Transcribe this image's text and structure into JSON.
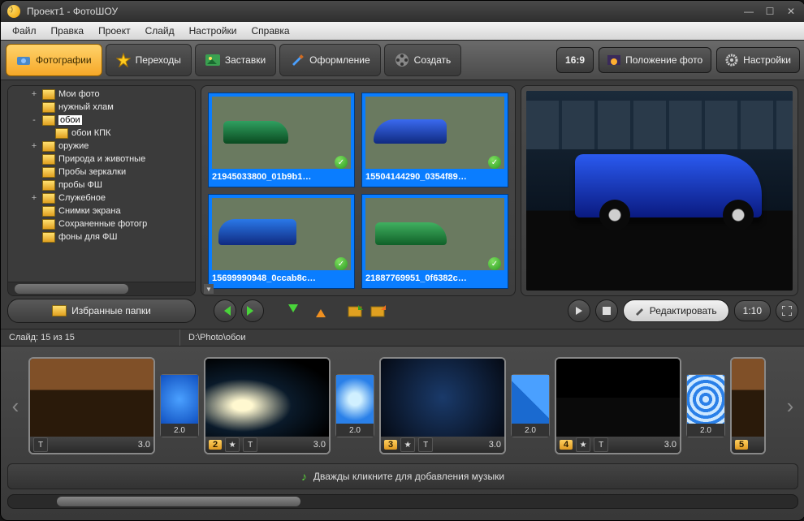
{
  "window": {
    "title": "Проект1 - ФотоШОУ"
  },
  "menu": {
    "file": "Файл",
    "edit": "Правка",
    "project": "Проект",
    "slide": "Слайд",
    "settings": "Настройки",
    "help": "Справка"
  },
  "tabs": {
    "photos": "Фотографии",
    "transitions": "Переходы",
    "intros": "Заставки",
    "design": "Оформление",
    "create": "Создать"
  },
  "toolbar_right": {
    "aspect": "16:9",
    "photopos": "Положение фото",
    "settings": "Настройки"
  },
  "folders": {
    "items": [
      {
        "indent": 1,
        "exp": "+",
        "label": "Мои фото"
      },
      {
        "indent": 1,
        "exp": "",
        "label": "нужный хлам"
      },
      {
        "indent": 1,
        "exp": "-",
        "label": "обои",
        "selected": true
      },
      {
        "indent": 2,
        "exp": "",
        "label": "обои КПК"
      },
      {
        "indent": 1,
        "exp": "+",
        "label": "оружие"
      },
      {
        "indent": 1,
        "exp": "",
        "label": "Природа и животные"
      },
      {
        "indent": 1,
        "exp": "",
        "label": "Пробы зеркалки"
      },
      {
        "indent": 1,
        "exp": "",
        "label": "пробы ФШ"
      },
      {
        "indent": 1,
        "exp": "+",
        "label": "Служебное"
      },
      {
        "indent": 1,
        "exp": "",
        "label": "Снимки экрана"
      },
      {
        "indent": 1,
        "exp": "",
        "label": "Сохраненные фотогр"
      },
      {
        "indent": 1,
        "exp": "",
        "label": "фоны для ФШ"
      }
    ],
    "favorites_btn": "Избранные папки"
  },
  "thumbs": [
    {
      "caption": "21945033800_01b9b1…"
    },
    {
      "caption": "15504144290_0354f89…"
    },
    {
      "caption": "15699990948_0ccab8c…"
    },
    {
      "caption": "21887769951_0f6382c…"
    }
  ],
  "preview": {
    "edit_btn": "Редактировать",
    "length": "1:10"
  },
  "status": {
    "slide": "Слайд: 15 из 15",
    "path": "D:\\Photo\\обои"
  },
  "timeline": {
    "slides": [
      {
        "idx": "",
        "dur": "3.0"
      },
      {
        "idx": "2",
        "dur": "3.0"
      },
      {
        "idx": "3",
        "dur": "3.0"
      },
      {
        "idx": "4",
        "dur": "3.0"
      },
      {
        "idx": "5",
        "dur": ""
      }
    ],
    "trans_dur": "2.0",
    "music_hint": "Дважды кликните для добавления музыки"
  }
}
